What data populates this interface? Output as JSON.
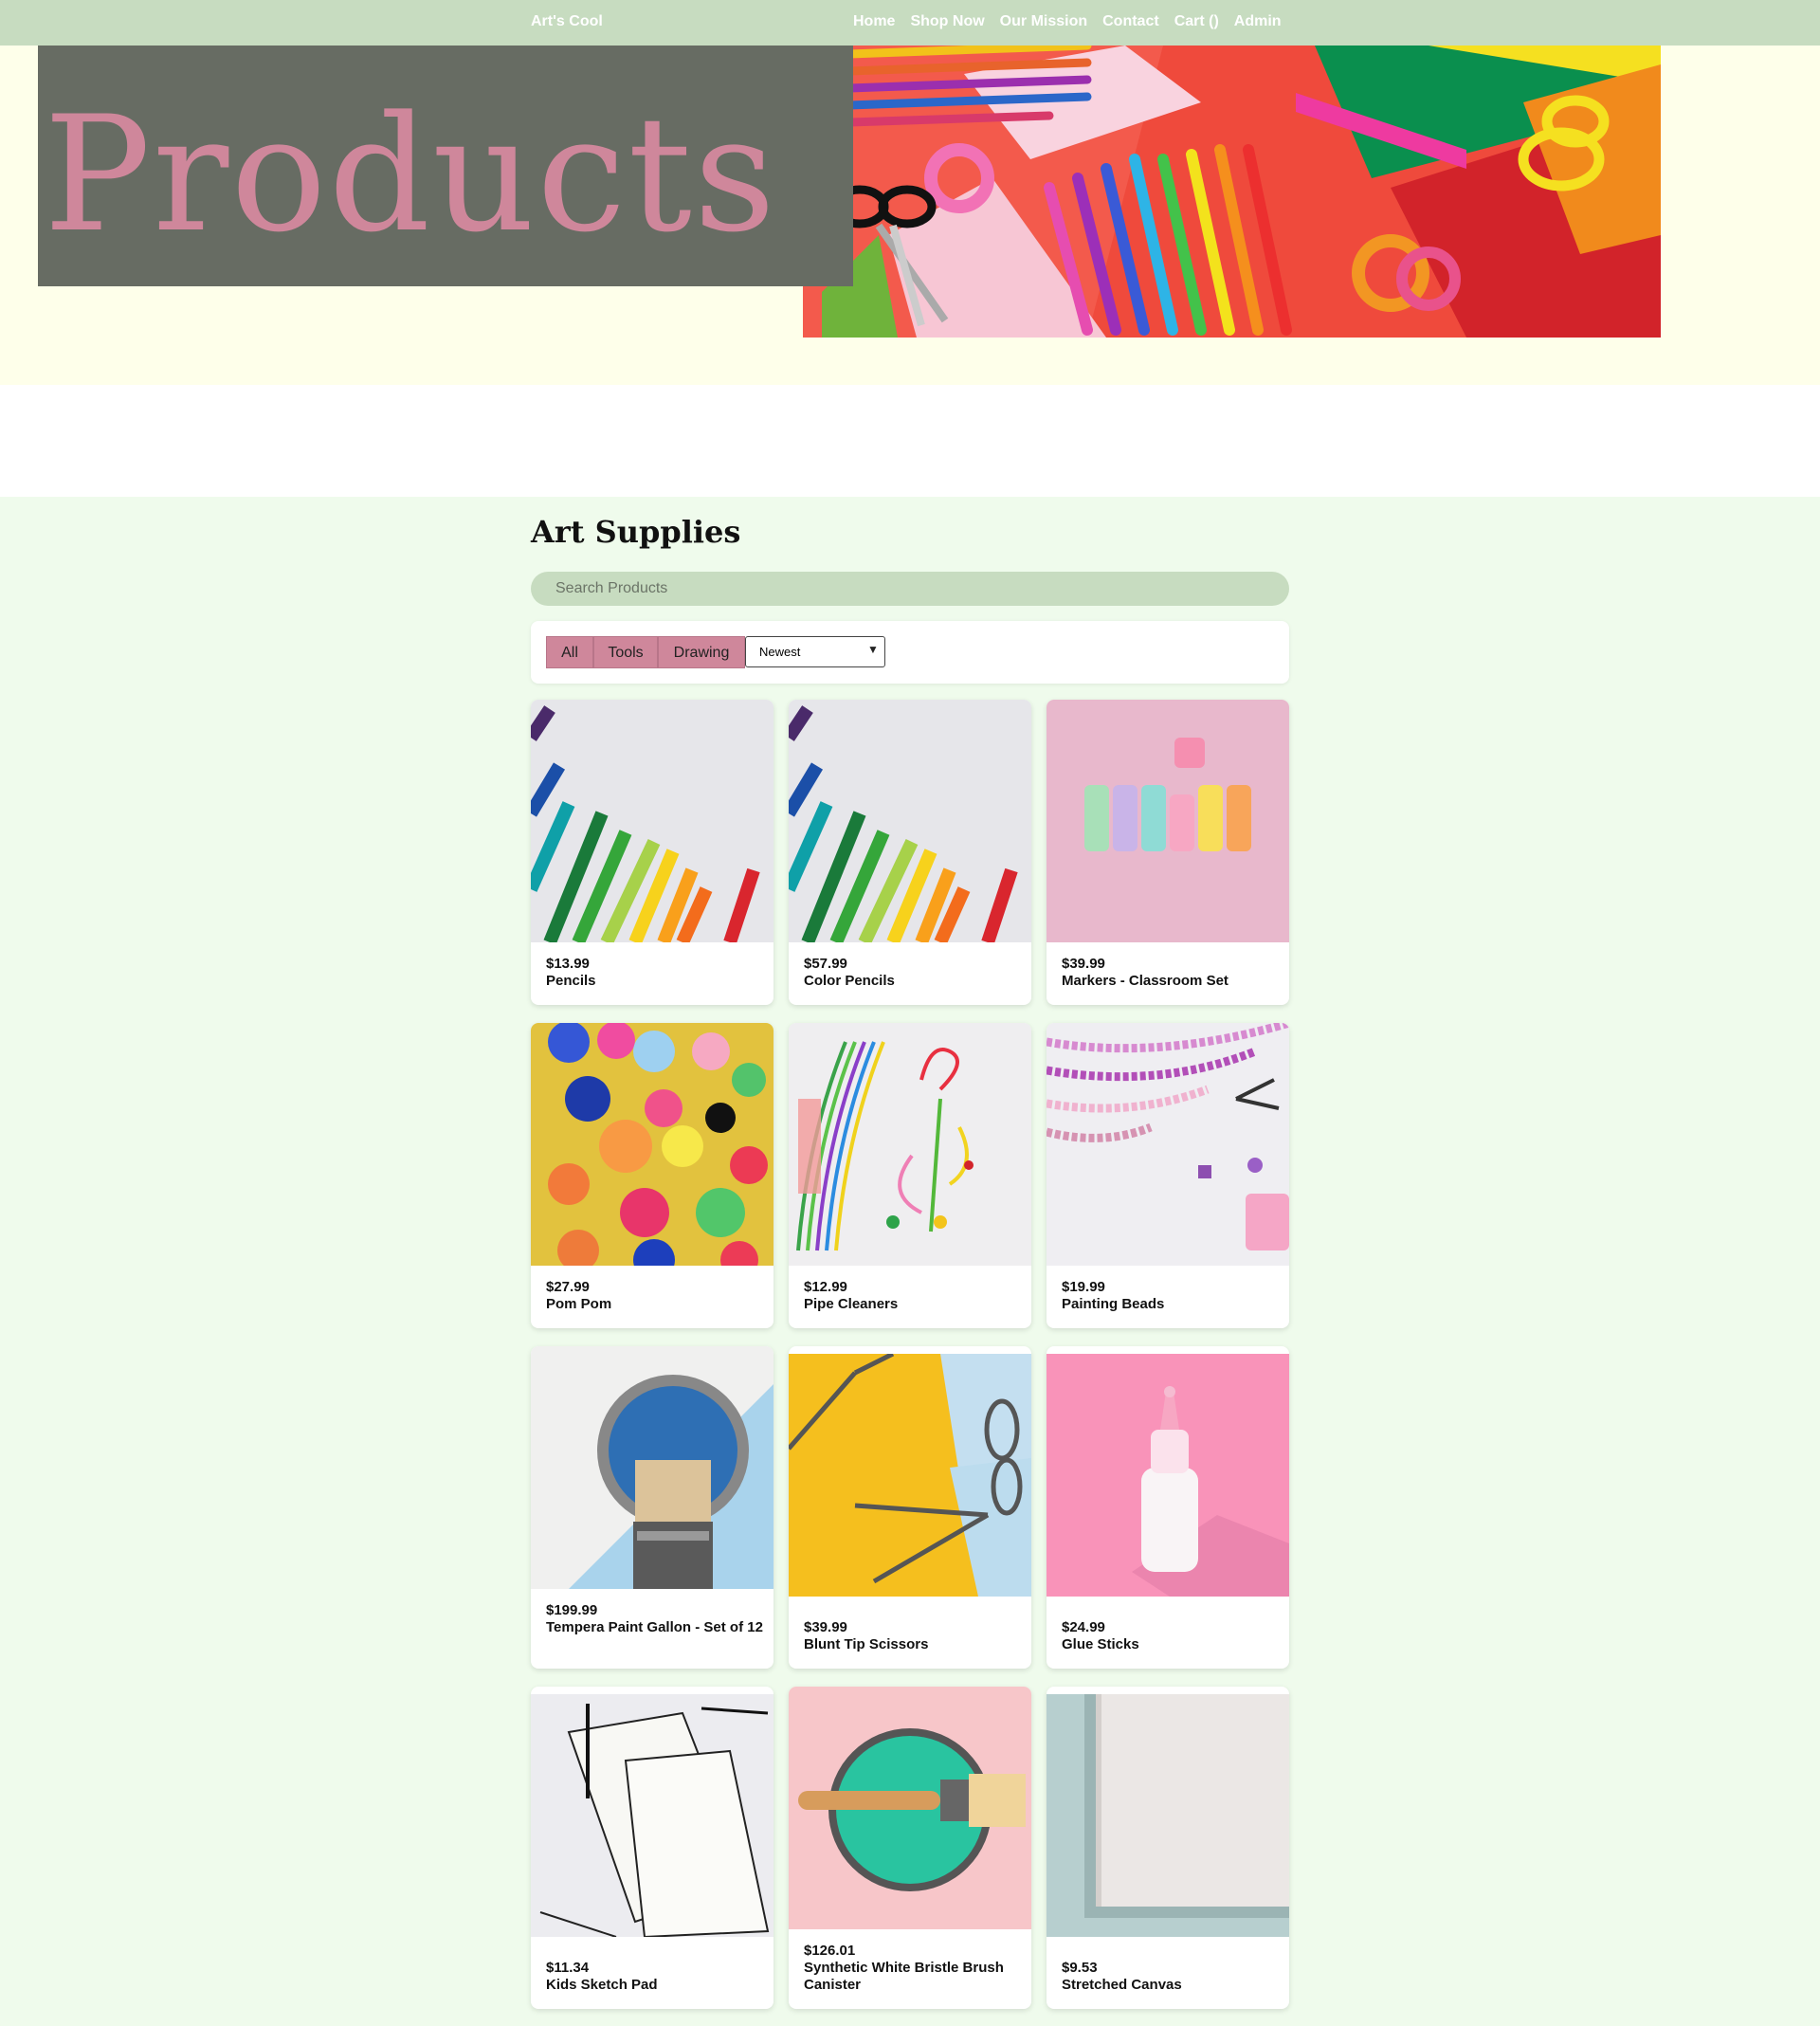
{
  "nav": {
    "brand": "Art's Cool",
    "links": [
      "Home",
      "Shop Now",
      "Our Mission",
      "Contact",
      "Cart ()",
      "Admin"
    ]
  },
  "hero": {
    "title": "Products"
  },
  "section": {
    "title": "Art Supplies"
  },
  "search": {
    "placeholder": "Search Products"
  },
  "filters": {
    "buttons": [
      "All",
      "Tools",
      "Drawing"
    ],
    "sort_selected": "Newest"
  },
  "products": [
    {
      "price": "$13.99",
      "name": "Pencils"
    },
    {
      "price": "$57.99",
      "name": "Color Pencils"
    },
    {
      "price": "$39.99",
      "name": "Markers - Classroom Set"
    },
    {
      "price": "$27.99",
      "name": "Pom Pom"
    },
    {
      "price": "$12.99",
      "name": "Pipe Cleaners"
    },
    {
      "price": "$19.99",
      "name": "Painting Beads"
    },
    {
      "price": "$199.99",
      "name": "Tempera Paint Gallon - Set of 12"
    },
    {
      "price": "$39.99",
      "name": "Blunt Tip Scissors"
    },
    {
      "price": "$24.99",
      "name": "Glue Sticks"
    },
    {
      "price": "$11.34",
      "name": "Kids Sketch Pad"
    },
    {
      "price": "$126.01",
      "name": "Synthetic White Bristle Brush Canister"
    },
    {
      "price": "$9.53",
      "name": "Stretched Canvas"
    }
  ],
  "colors": {
    "nav_bg": "#c7dcc0",
    "accent_pink": "#cf879b",
    "hero_box": "#676c63",
    "page_bg": "#effbec"
  }
}
